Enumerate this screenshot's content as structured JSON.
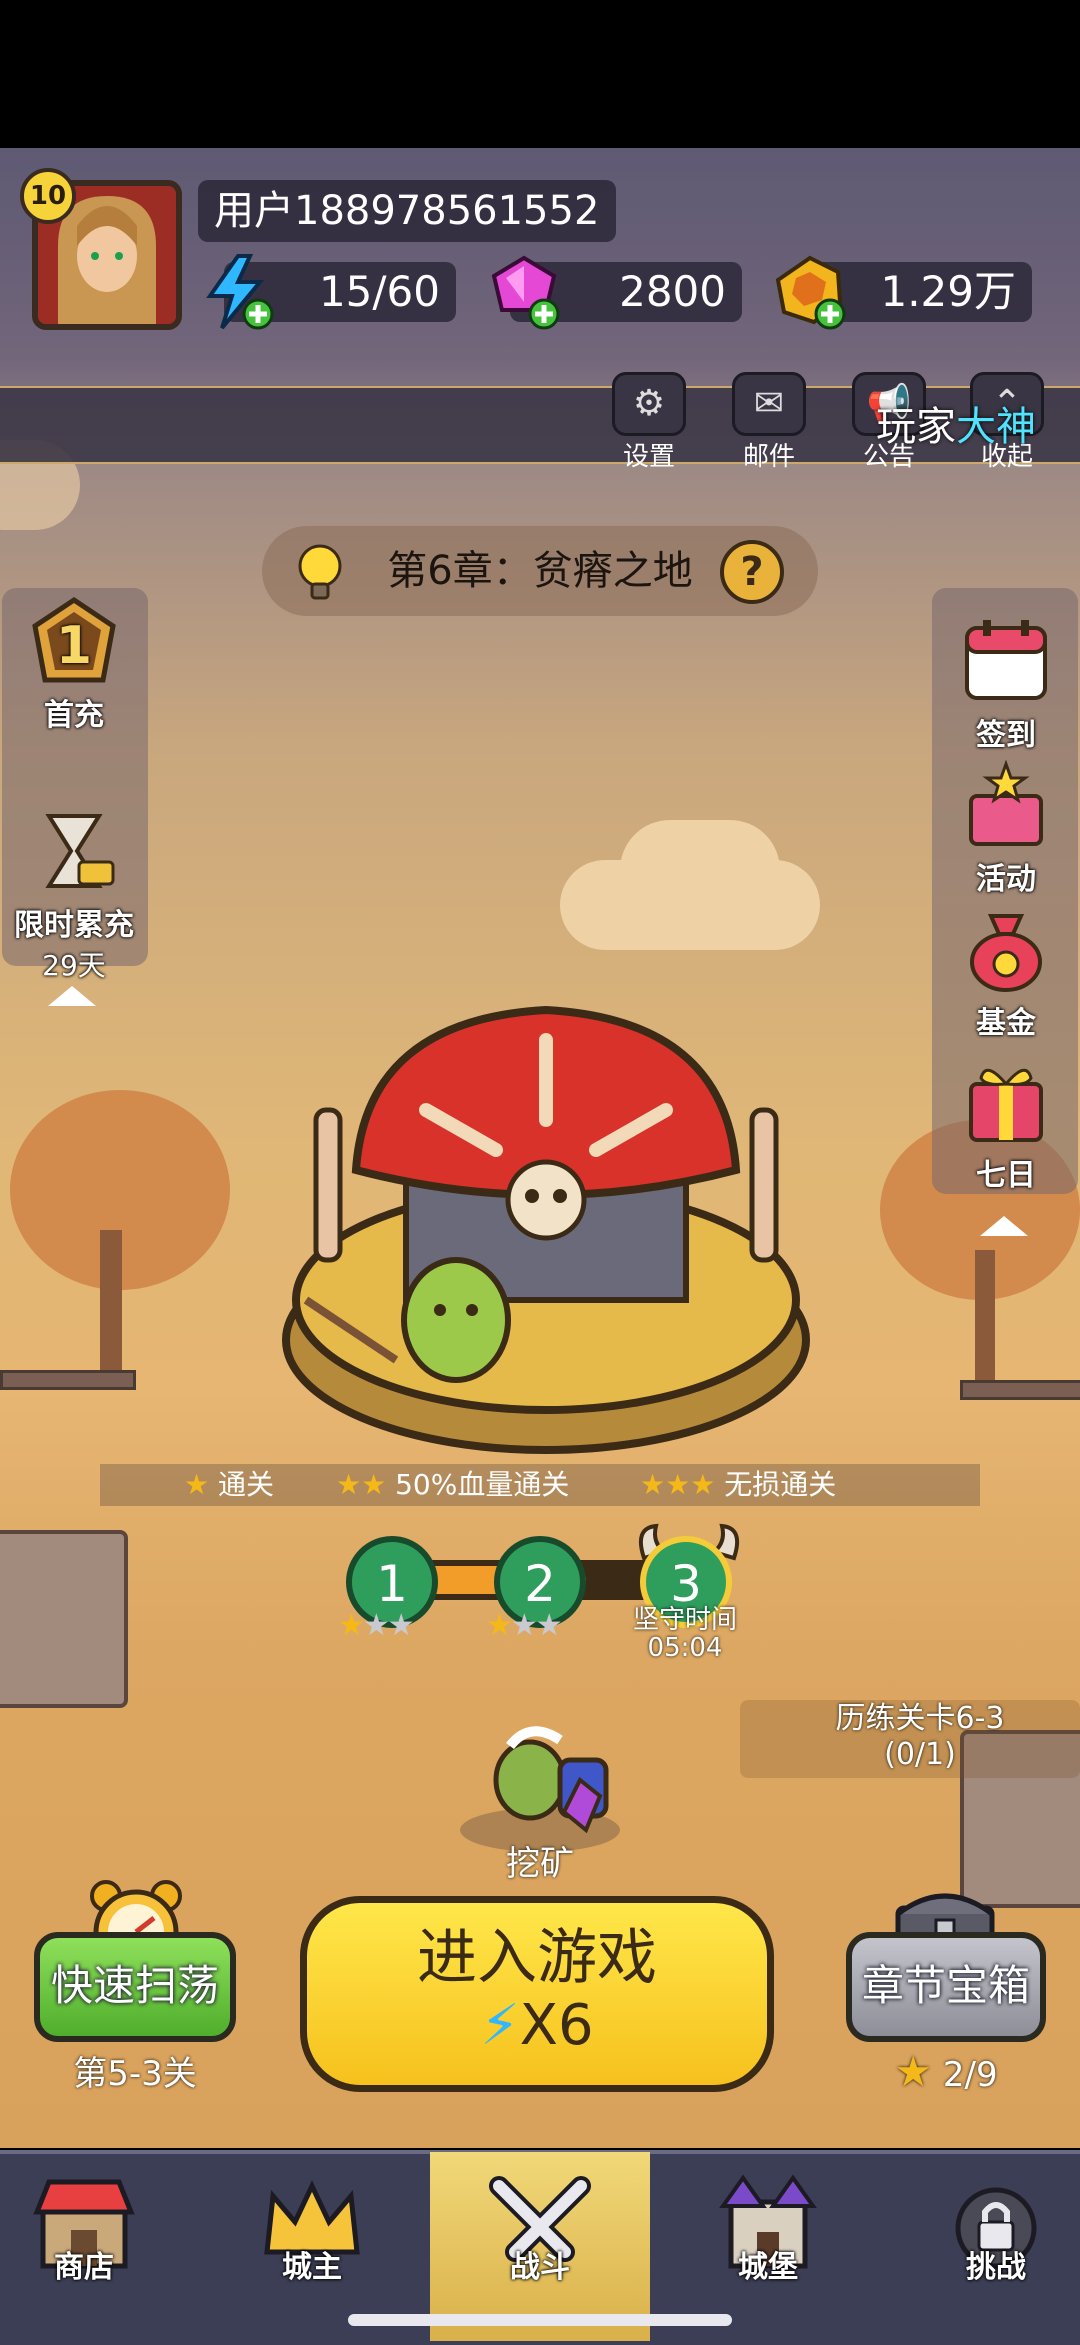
{
  "player": {
    "level": "10",
    "username": "用户188978561552"
  },
  "resources": {
    "energy": "15/60",
    "gems": "2800",
    "gold": "1.29万"
  },
  "top_buttons": [
    {
      "label": "设置",
      "icon": "gear-icon"
    },
    {
      "label": "邮件",
      "icon": "mail-icon"
    },
    {
      "label": "公告",
      "icon": "announcement-icon"
    },
    {
      "label": "收起",
      "icon": "collapse-icon"
    }
  ],
  "banner": {
    "prefix": "玩家",
    "highlight": "大神"
  },
  "chapter": {
    "title": "第6章：贫瘠之地"
  },
  "left_side": {
    "first_charge": {
      "badge": "1",
      "label": "首充"
    },
    "limited_charge": {
      "label": "限时累充",
      "days": "29天"
    }
  },
  "right_side": [
    {
      "label": "签到",
      "icon": "calendar-icon"
    },
    {
      "label": "活动",
      "icon": "gift-box-icon"
    },
    {
      "label": "基金",
      "icon": "money-bag-icon"
    },
    {
      "label": "七日",
      "icon": "present-icon"
    }
  ],
  "conditions": [
    {
      "stars": 1,
      "label": "通关"
    },
    {
      "stars": 2,
      "label": "50%血量通关"
    },
    {
      "stars": 3,
      "label": "无损通关"
    }
  ],
  "stages": [
    {
      "number": "1",
      "stars_earned": 1
    },
    {
      "number": "2",
      "stars_earned": 1
    },
    {
      "number": "3",
      "stars_earned": 0
    }
  ],
  "hold": {
    "label": "坚守时间",
    "time": "05:04"
  },
  "training": {
    "label": "历练关卡6-3",
    "progress": "(0/1)"
  },
  "mining": {
    "label": "挖矿"
  },
  "sweep": {
    "button_label": "快速扫荡",
    "stage_label": "第5-3关"
  },
  "enter": {
    "label": "进入游戏",
    "cost": "X6"
  },
  "chest": {
    "button_label": "章节宝箱",
    "progress": "2/9"
  },
  "nav": [
    {
      "label": "商店",
      "icon": "shop-icon"
    },
    {
      "label": "城主",
      "icon": "crown-icon"
    },
    {
      "label": "战斗",
      "icon": "crossed-swords-icon",
      "active": true
    },
    {
      "label": "城堡",
      "icon": "castle-icon"
    },
    {
      "label": "挑战",
      "icon": "locked-challenge-icon"
    }
  ],
  "colors": {
    "accent_yellow": "#f6c11d",
    "active_tab": "#e9c85a",
    "stage_green": "#2f9d5c",
    "highlight_cyan": "#4fe3ff"
  }
}
